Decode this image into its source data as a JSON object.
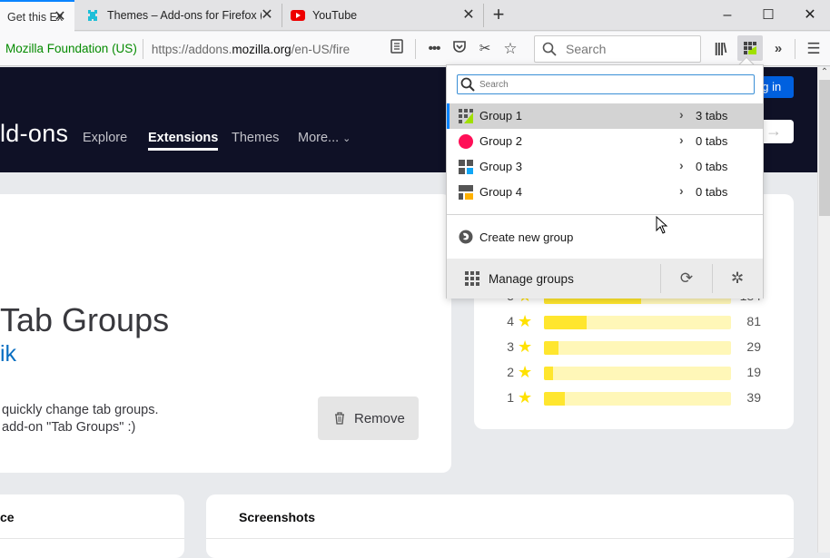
{
  "browser": {
    "tabs": [
      {
        "title": "Get this Ex",
        "active": true,
        "favicon": "addon-icon"
      },
      {
        "title": "Themes – Add-ons for Firefox (",
        "active": false,
        "favicon": "puzzle-icon"
      },
      {
        "title": "YouTube",
        "active": false,
        "favicon": "youtube-icon"
      }
    ],
    "new_tab_label": "+",
    "window_controls": {
      "minimize": "–",
      "maximize": "☐",
      "close": "✕"
    },
    "identity": "Mozilla Foundation (US)",
    "url_prefix": "https://addons.",
    "url_domain": "mozilla.org",
    "url_suffix": "/en-US/fire",
    "search_placeholder": "Search",
    "toolbar_icons": [
      "reader-view-icon",
      "more-icon",
      "pocket-icon",
      "screenshot-icon",
      "bookmark-star-icon",
      "library-icon",
      "tab-groups-icon",
      "overflow-icon",
      "menu-icon"
    ]
  },
  "site": {
    "brand": "ld-ons",
    "nav": [
      {
        "label": "Explore",
        "active": false
      },
      {
        "label": "Extensions",
        "active": true
      },
      {
        "label": "Themes",
        "active": false
      },
      {
        "label": "More...",
        "active": false
      }
    ],
    "login_label": "og in",
    "addon": {
      "title": "Tab Groups",
      "author": "ik",
      "description_line1": "quickly change tab groups.",
      "description_line2": "add-on \"Tab Groups\" :)",
      "remove_label": "Remove"
    },
    "ratings": [
      {
        "stars": "5",
        "count": "184",
        "fraction": 0.52
      },
      {
        "stars": "4",
        "count": "81",
        "fraction": 0.23
      },
      {
        "stars": "3",
        "count": "29",
        "fraction": 0.08
      },
      {
        "stars": "2",
        "count": "19",
        "fraction": 0.05
      },
      {
        "stars": "1",
        "count": "39",
        "fraction": 0.11
      }
    ],
    "sections": [
      {
        "heading": "ce"
      },
      {
        "heading": "Screenshots"
      }
    ]
  },
  "popup": {
    "search_placeholder": "Search",
    "groups": [
      {
        "name": "Group 1",
        "tabs": "3 tabs",
        "selected": true,
        "icon": "tab-grid-green-icon",
        "color": "#a0e000"
      },
      {
        "name": "Group 2",
        "tabs": "0 tabs",
        "selected": false,
        "icon": "circle-icon",
        "color": "#ff0f57"
      },
      {
        "name": "Group 3",
        "tabs": "0 tabs",
        "selected": false,
        "icon": "tab-grid-blue-icon",
        "color": "#10a6f5"
      },
      {
        "name": "Group 4",
        "tabs": "0 tabs",
        "selected": false,
        "icon": "tab-grid-orange-icon",
        "color": "#ffb100"
      }
    ],
    "create_label": "Create new group",
    "manage_label": "Manage groups"
  }
}
